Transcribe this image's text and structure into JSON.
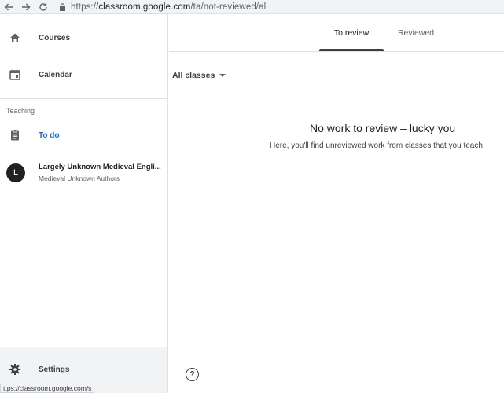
{
  "browser": {
    "url_scheme": "https://",
    "url_host": "classroom.google.com",
    "url_path": "/ta/not-reviewed/all"
  },
  "sidebar": {
    "courses_label": "Courses",
    "calendar_label": "Calendar",
    "section_teaching": "Teaching",
    "todo_label": "To do",
    "class": {
      "avatar_letter": "L",
      "title": "Largely Unknown Medieval Engli...",
      "subtitle": "Medieval Unknown Authors"
    },
    "settings_label": "Settings"
  },
  "status_bar": {
    "url": "ttps://classroom.google.com/s"
  },
  "tabs": [
    {
      "label": "To review",
      "active": true
    },
    {
      "label": "Reviewed",
      "active": false
    }
  ],
  "filter": {
    "selected": "All classes"
  },
  "empty_state": {
    "title": "No work to review – lucky you",
    "subtitle": "Here, you'll find unreviewed work from classes that you teach"
  },
  "help": {
    "symbol": "?"
  },
  "colors": {
    "active_accent": "#1967d2",
    "tab_indicator": "#3c4043",
    "sidebar_footer_bg": "#f1f3f4"
  },
  "icons": {
    "back": "arrow-left-icon",
    "forward": "arrow-right-icon",
    "reload": "reload-icon",
    "lock": "lock-icon",
    "courses": "home-icon",
    "calendar": "calendar-icon",
    "todo": "assignment-icon",
    "settings": "gear-icon",
    "help": "help-circle-icon"
  }
}
